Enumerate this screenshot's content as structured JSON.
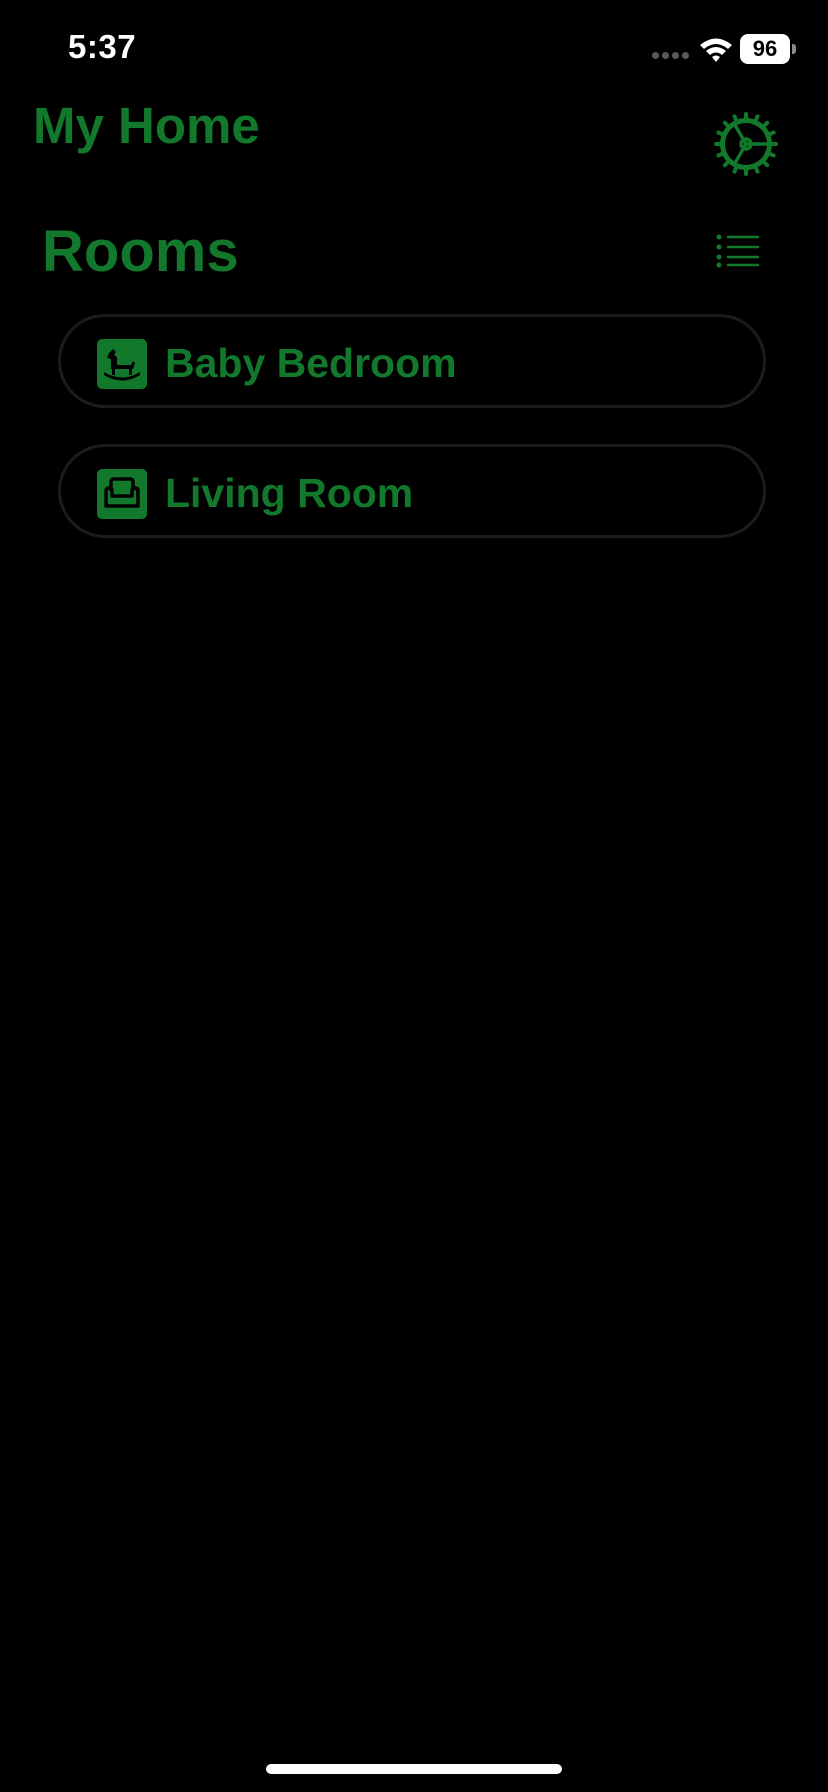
{
  "status_bar": {
    "time": "5:37",
    "battery_level": "96",
    "icons": [
      "signal-dots-icon",
      "wifi-icon",
      "battery-icon"
    ]
  },
  "header": {
    "title": "My Home",
    "settings_icon": "gear-icon"
  },
  "rooms_section": {
    "title": "Rooms",
    "list_view_icon": "list-icon",
    "rooms": [
      {
        "label": "Baby Bedroom",
        "icon": "rocking-horse-icon"
      },
      {
        "label": "Living Room",
        "icon": "armchair-icon"
      }
    ]
  },
  "colors": {
    "accent": "#12782b",
    "background": "#000000",
    "card_border": "#1c1c1e",
    "status_text": "#ffffff"
  }
}
